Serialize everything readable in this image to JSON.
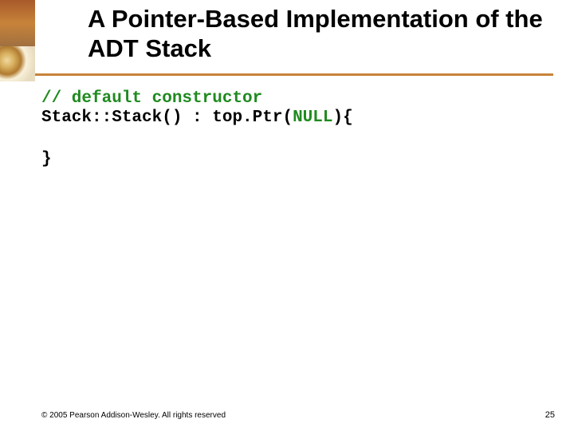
{
  "title": "A Pointer-Based Implementation of the ADT Stack",
  "code": {
    "comment": "// default constructor",
    "line_pre": "Stack::Stack() : top.Ptr(",
    "null": "NULL",
    "line_post": "){",
    "close": "}"
  },
  "footer": {
    "copyright": "© 2005 Pearson Addison-Wesley. All rights reserved",
    "page": "25"
  }
}
